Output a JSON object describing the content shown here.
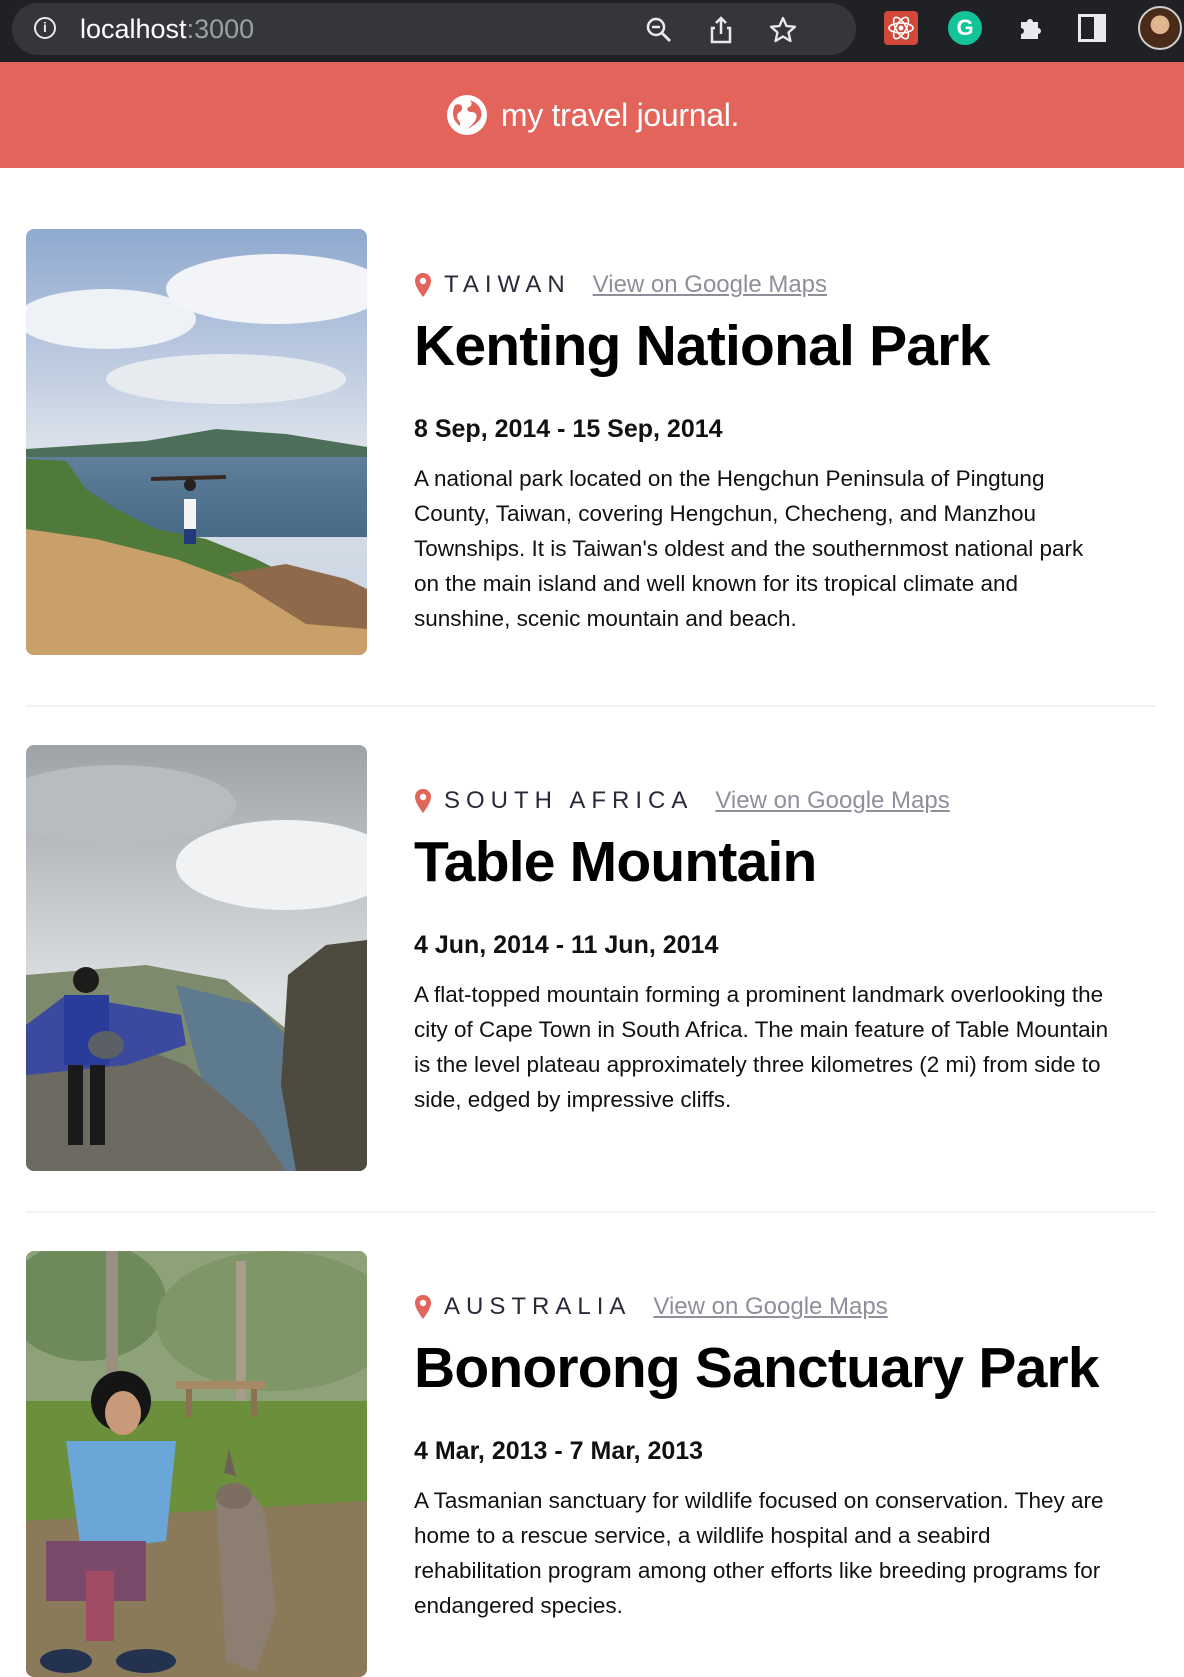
{
  "browser": {
    "url_host": "localhost",
    "url_port": ":3000",
    "icons": [
      "info-icon",
      "zoom-icon",
      "share-icon",
      "bookmark-star-icon",
      "react-devtools-icon",
      "grammarly-icon",
      "extensions-icon",
      "side-panel-icon",
      "profile-avatar"
    ],
    "grammarly_label": "G"
  },
  "header": {
    "title": "my travel journal.",
    "background": "#e2645a"
  },
  "entries": [
    {
      "country": "TAIWAN",
      "maps_label": "View on Google Maps",
      "title": "Kenting National Park",
      "dates": "8 Sep, 2014 - 15 Sep, 2014",
      "description": "A national park located on the Hengchun Peninsula of Pingtung County, Taiwan, covering Hengchun, Checheng, and Manzhou Townships. It is Taiwan's oldest and the southernmost national park on the main island and well known for its tropical climate and sunshine, scenic mountain and beach."
    },
    {
      "country": "SOUTH AFRICA",
      "maps_label": "View on Google Maps",
      "title": "Table Mountain",
      "dates": "4 Jun, 2014 - 11 Jun, 2014",
      "description": "A flat-topped mountain forming a prominent landmark overlooking the city of Cape Town in South Africa. The main feature of Table Mountain is the level plateau approximately three kilometres (2 mi) from side to side, edged by impressive cliffs."
    },
    {
      "country": "AUSTRALIA",
      "maps_label": "View on Google Maps",
      "title": "Bonorong Sanctuary Park",
      "dates": "4 Mar, 2013 - 7 Mar, 2013",
      "description": "A Tasmanian sanctuary for wildlife focused on conservation. They are home to a rescue service, a wildlife hospital and a seabird rehabilitation program among other efforts like breeding programs for endangered species."
    }
  ],
  "colors": {
    "accent": "#e2645a",
    "link": "#918e9b",
    "country_text": "#2b283a"
  }
}
